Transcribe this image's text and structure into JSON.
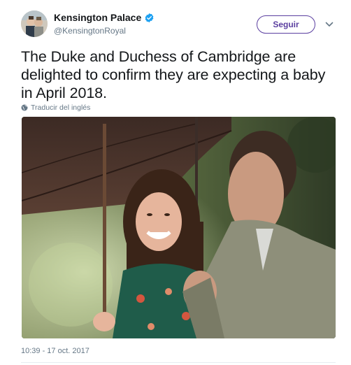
{
  "author": {
    "name": "Kensington Palace",
    "handle": "@KensingtonRoyal",
    "verified": true,
    "avatar_icon": "avatar-photo"
  },
  "actions": {
    "follow_label": "Seguir",
    "more_icon": "chevron-down-icon"
  },
  "tweet": {
    "text": "The Duke and Duchess of Cambridge are delighted to confirm they are expecting a baby in April 2018.",
    "translate_label": "Traducir del inglés",
    "timestamp": "10:39 - 17 oct. 2017"
  },
  "colors": {
    "accent": "#5b3fa0",
    "verified": "#1da1f2",
    "secondary_text": "#657786",
    "text": "#14171a"
  }
}
